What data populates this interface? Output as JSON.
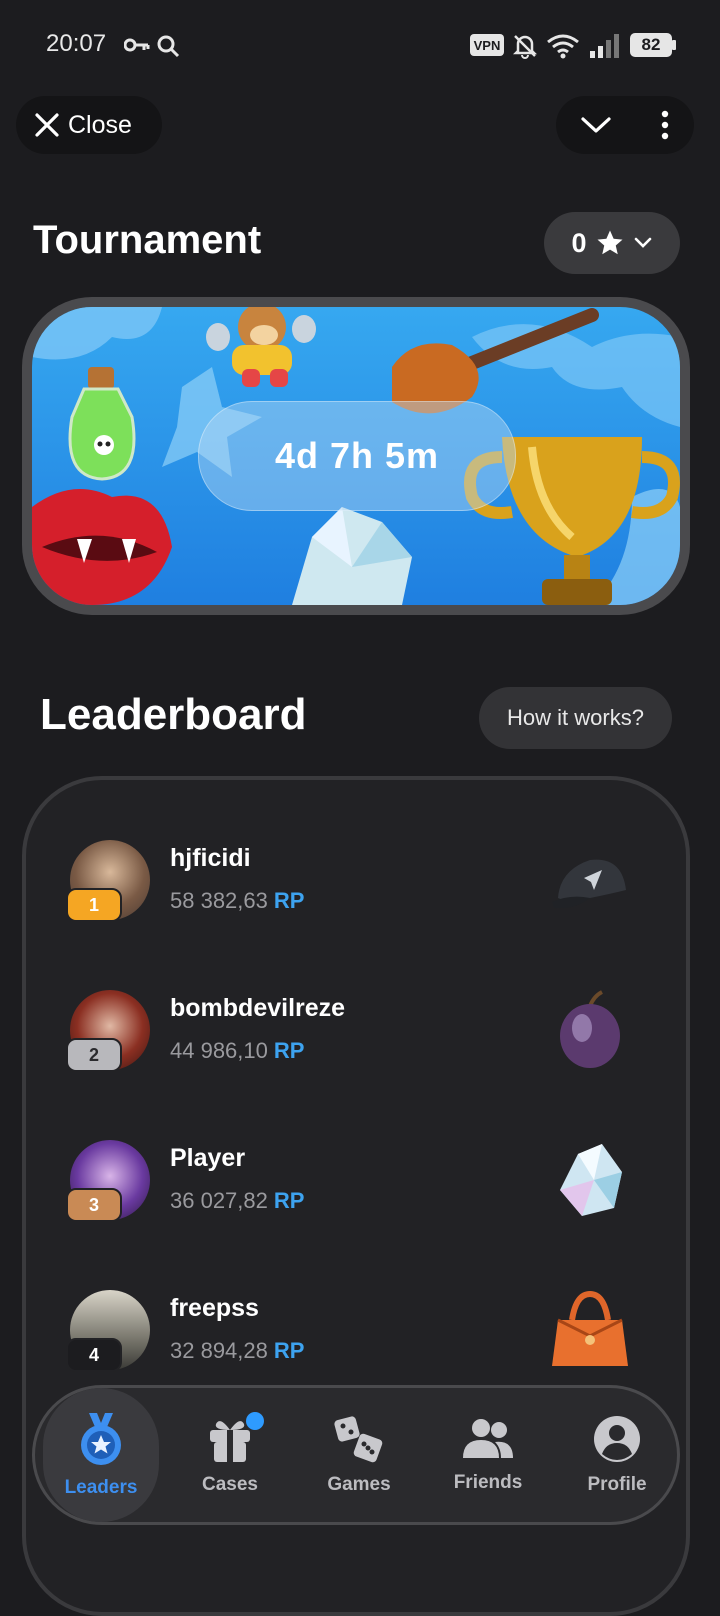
{
  "status_bar": {
    "time": "20:07",
    "vpn": "VPN",
    "battery": "82",
    "icons": [
      "key-icon",
      "search-icon",
      "bell-off-icon",
      "wifi-icon",
      "signal-icon",
      "battery-icon"
    ]
  },
  "header": {
    "close_label": "Close",
    "icons": [
      "close-icon",
      "chevron-down-icon",
      "more-vertical-icon"
    ]
  },
  "tournament": {
    "title": "Tournament",
    "stars_count": "0",
    "timer": "4d 7h 5m"
  },
  "leaderboard": {
    "title": "Leaderboard",
    "how_label": "How it works?",
    "entries": [
      {
        "rank": "1",
        "name": "hjficidi",
        "score": "58 382,63",
        "unit": "RP",
        "prize": "cap",
        "rank_color": "#f5a623"
      },
      {
        "rank": "2",
        "name": "bombdevilreze",
        "score": "44 986,10",
        "unit": "RP",
        "prize": "plum",
        "rank_color": "#b8b8bc"
      },
      {
        "rank": "3",
        "name": "Player",
        "score": "36 027,82",
        "unit": "RP",
        "prize": "crystal",
        "rank_color": "#c98a55"
      },
      {
        "rank": "4",
        "name": "freepss",
        "score": "32 894,28",
        "unit": "RP",
        "prize": "bag",
        "rank_color": "#1c1c1f"
      }
    ]
  },
  "nav": {
    "items": [
      {
        "label": "Leaders",
        "icon": "medal-icon",
        "active": true
      },
      {
        "label": "Cases",
        "icon": "gift-icon",
        "active": false
      },
      {
        "label": "Games",
        "icon": "dice-icon",
        "active": false
      },
      {
        "label": "Friends",
        "icon": "friends-icon",
        "active": false
      },
      {
        "label": "Profile",
        "icon": "profile-icon",
        "active": false
      }
    ]
  },
  "colors": {
    "background": "#1c1c1f",
    "accent": "#3da3f0",
    "banner": "#2b94ea"
  }
}
